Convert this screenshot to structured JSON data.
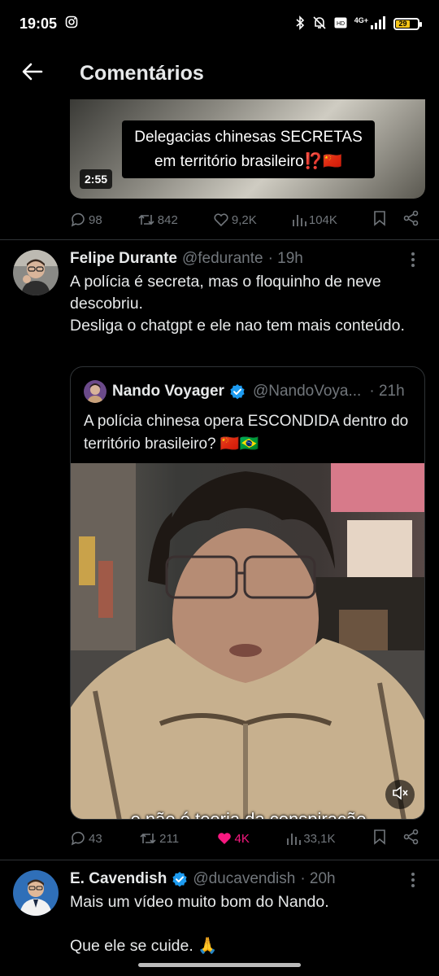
{
  "status_bar": {
    "time": "19:05",
    "network": "4G+",
    "battery_level": "29",
    "battery_fraction": 0.29,
    "icons": [
      "instagram-icon",
      "bluetooth-icon",
      "mute-bell-icon",
      "volte-icon",
      "signal-icon",
      "battery-icon"
    ]
  },
  "header": {
    "title": "Comentários",
    "back_icon": "arrow-left-icon"
  },
  "top_post": {
    "video_caption_line1": "Delegacias chinesas SECRETAS",
    "video_caption_line2": "em território brasileiro⁉️🇨🇳",
    "duration": "2:55",
    "stats": {
      "replies": "98",
      "reposts": "842",
      "likes": "9,2K",
      "views": "104K"
    }
  },
  "reply1": {
    "name": "Felipe Durante",
    "handle": "@fedurante",
    "time": "· 19h",
    "text": "A polícia é secreta, mas o floquinho de neve descobriu.\nDesliga o chatgpt e ele nao tem mais conteúdo.",
    "quote": {
      "name": "Nando Voyager",
      "handle": "@NandoVoya...",
      "time": "· 21h",
      "text": "A polícia chinesa opera ESCONDIDA dentro do território brasileiro? 🇨🇳🇧🇷",
      "subtitle": "e não é teoria da conspiração"
    },
    "stats": {
      "replies": "43",
      "reposts": "211",
      "likes": "4K",
      "views": "33,1K"
    }
  },
  "reply2": {
    "name": "E. Cavendish",
    "handle": "@ducavendish",
    "time": "· 20h",
    "text": "Mais um vídeo muito bom do Nando.\n\nQue ele se cuide. 🙏"
  },
  "colors": {
    "background": "#000000",
    "text": "#e7e9ea",
    "secondary": "#71767b",
    "like": "#f91880",
    "verified": "#1d9bf0"
  }
}
